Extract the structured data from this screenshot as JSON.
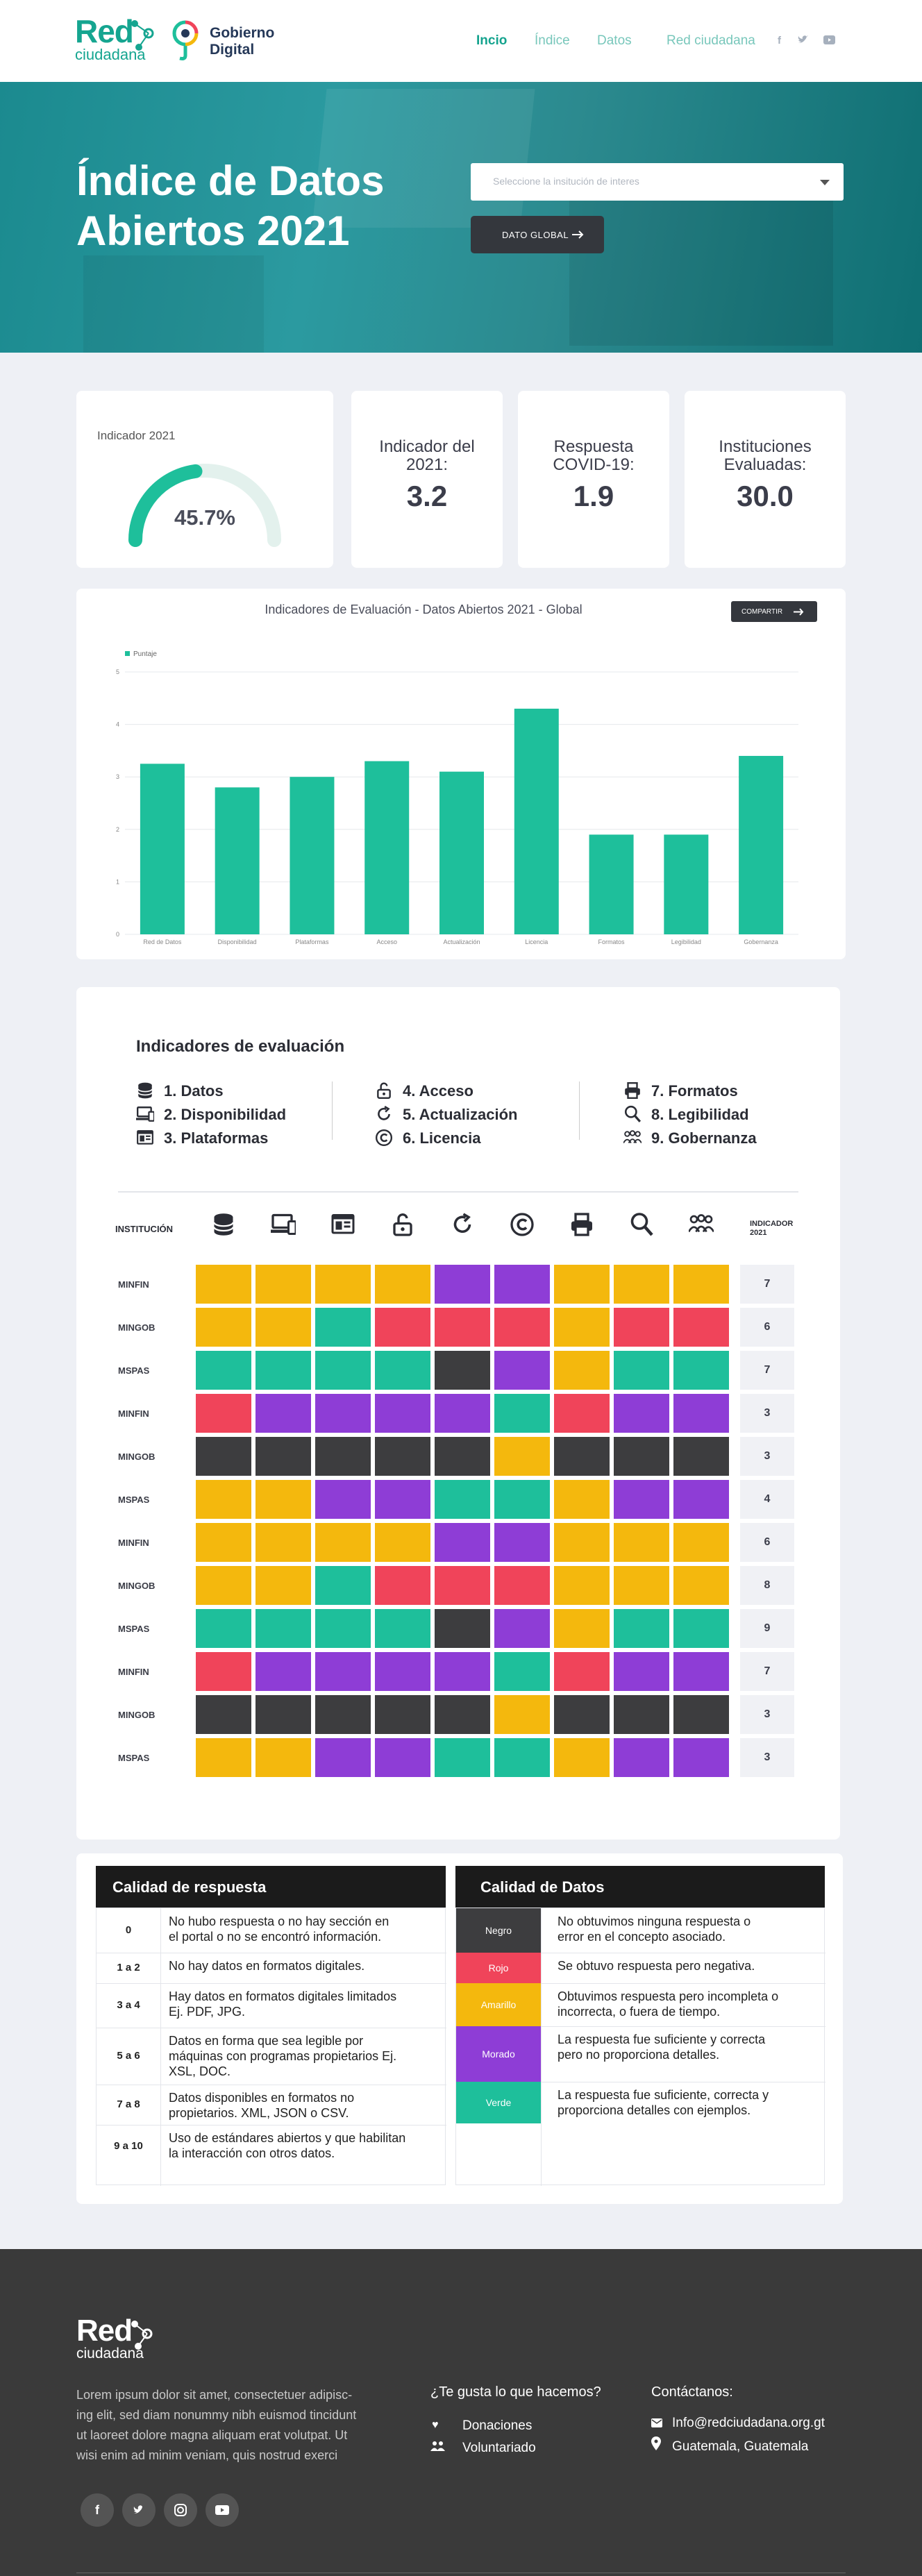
{
  "nav": {
    "logo_top": "Red",
    "logo_bottom": "ciudadana",
    "gob_line1": "Gobierno",
    "gob_line2": "Digital",
    "links": [
      "Incio",
      "Índice",
      "Datos",
      "Red ciudadana"
    ],
    "social": [
      "f",
      "t",
      "yt"
    ]
  },
  "hero": {
    "title_line1": "Índice de Datos",
    "title_line2": "Abiertos 2021",
    "select_placeholder": "Seleccione la insitución de  interes",
    "button_label": "DATO GLOBAL"
  },
  "stats": {
    "gauge_label": "Indicador 2021",
    "gauge_value": "45.7%",
    "gauge_fraction": 0.457,
    "cards": [
      {
        "label_l1": "Indicador del",
        "label_l2": "2021:",
        "value": "3.2"
      },
      {
        "label_l1": "Respuesta",
        "label_l2": "COVID-19:",
        "value": "1.9"
      },
      {
        "label_l1": "Instituciones",
        "label_l2": "Evaluadas:",
        "value": "30.0"
      }
    ]
  },
  "chart_section": {
    "title": "Indicadores de Evaluación - Datos Abiertos 2021 - Global",
    "share_label": "COMPARTIR"
  },
  "chart_data": {
    "type": "bar",
    "categories": [
      "Red de Datos",
      "Disponibilidad",
      "Plataformas",
      "Acceso",
      "Actualización",
      "Licencia",
      "Formatos",
      "Legibilidad",
      "Gobernanza"
    ],
    "series": [
      {
        "name": "Puntaje",
        "values": [
          3.25,
          2.8,
          3.0,
          3.3,
          3.1,
          4.3,
          1.9,
          1.9,
          3.4
        ],
        "color": "#1ebf9b"
      }
    ],
    "yticks": [
      "0",
      "1",
      "2",
      "3",
      "4",
      "5"
    ],
    "ylim": [
      0,
      5
    ],
    "grid": true,
    "legend": "top-left"
  },
  "indicators": {
    "title": "Indicadores de  evaluación",
    "legend": [
      {
        "label": "1. Datos",
        "icon": "database-icon"
      },
      {
        "label": "2. Disponibilidad",
        "icon": "devices-icon"
      },
      {
        "label": "3. Plataformas",
        "icon": "browser-icon"
      },
      {
        "label": "4. Acceso",
        "icon": "unlock-icon"
      },
      {
        "label": "5. Actualización",
        "icon": "refresh-icon"
      },
      {
        "label": "6. Licencia",
        "icon": "copyright-icon"
      },
      {
        "label": "7. Formatos",
        "icon": "printer-icon"
      },
      {
        "label": "8. Legibilidad",
        "icon": "magnifier-icon"
      },
      {
        "label": "9. Gobernanza",
        "icon": "people-icon"
      }
    ],
    "col_head_left": "INSTITUCIÓN",
    "col_head_right_l1": "INDICADOR",
    "col_head_right_l2": "2021",
    "colors": {
      "Y": "#f4b80d",
      "P": "#8e3dd6",
      "G": "#1ebf9b",
      "R": "#f0445a",
      "K": "#3d3d3f"
    },
    "rows": [
      {
        "inst": "MINFIN",
        "cells": "YYYYPPYYY",
        "score": "7"
      },
      {
        "inst": "MINGOB",
        "cells": "YYGRRRYRR",
        "score": "6"
      },
      {
        "inst": "MSPAS",
        "cells": "GGGGKPYGG",
        "score": "7"
      },
      {
        "inst": "MINFIN",
        "cells": "RPPPPGRPP",
        "score": "3"
      },
      {
        "inst": "MINGOB",
        "cells": "KKKKKYKKK",
        "score": "3"
      },
      {
        "inst": "MSPAS",
        "cells": "YYPPGGYPP",
        "score": "4"
      },
      {
        "inst": "MINFIN",
        "cells": "YYYYPPYYY",
        "score": "6"
      },
      {
        "inst": "MINGOB",
        "cells": "YYGRRRYYY",
        "score": "8"
      },
      {
        "inst": "MSPAS",
        "cells": "GGGGKPYGG",
        "score": "9"
      },
      {
        "inst": "MINFIN",
        "cells": "RPPPPGRPP",
        "score": "7"
      },
      {
        "inst": "MINGOB",
        "cells": "KKKKKYKKK",
        "score": "3"
      },
      {
        "inst": "MSPAS",
        "cells": "YYPPGGYPP",
        "score": "3"
      }
    ]
  },
  "quality": {
    "title": "Calidad de respuesta",
    "rows": [
      {
        "key": "0",
        "text_l1": "No hubo respuesta o no hay sección en",
        "text_l2": "el portal o no se encontró información."
      },
      {
        "key": "1 a 2",
        "text_l1": "No hay datos en formatos digitales.",
        "text_l2": ""
      },
      {
        "key": "3 a 4",
        "text_l1": "Hay datos en formatos digitales limitados",
        "text_l2": "Ej. PDF, JPG."
      },
      {
        "key": "5 a 6",
        "text_l1": "Datos en forma que sea legible por",
        "text_l2": "máquinas con programas propietarios Ej.",
        "text_l3": "XSL, DOC."
      },
      {
        "key": "7 a 8",
        "text_l1": "Datos disponibles en formatos no",
        "text_l2": "propietarios. XML, JSON o CSV."
      },
      {
        "key": "9 a 10",
        "text_l1": " Uso de estándares abiertos y que habilitan",
        "text_l2": "la interacción con otros datos."
      }
    ]
  },
  "data_quality": {
    "title": "Calidad de Datos",
    "rows": [
      {
        "chip": "Negro",
        "color": "#3d3d3f",
        "text_l1": "No obtuvimos ninguna respuesta o",
        "text_l2": "error en el concepto asociado."
      },
      {
        "chip": "Rojo",
        "color": "#f0445a",
        "text_l1": "Se obtuvo respuesta pero negativa.",
        "text_l2": ""
      },
      {
        "chip": "Amarillo",
        "color": "#f4b80d",
        "text_l1": "Obtuvimos respuesta pero incompleta o",
        "text_l2": "incorrecta, o fuera de tiempo."
      },
      {
        "chip": "Morado",
        "color": "#8e3dd6",
        "text_l1": "La respuesta fue suficiente y correcta",
        "text_l2": "pero no proporciona detalles."
      },
      {
        "chip": "Verde",
        "color": "#1ebf9b",
        "text_l1": "La respuesta fue suficiente, correcta y",
        "text_l2": "proporciona detalles con ejemplos."
      }
    ]
  },
  "footer": {
    "logo_top": "Red",
    "logo_bottom": "ciudadana",
    "about_l1": " Lorem ipsum dolor sit amet, consectetuer adipisc-",
    "about_l2": "ing elit, sed diam nonummy nibh euismod tincidunt",
    "about_l3": "ut laoreet dolore magna aliquam erat volutpat. Ut",
    "about_l4": "wisi enim ad minim veniam, quis nostrud exerci",
    "col2_title": "¿Te gusta lo que hacemos?",
    "col2_items": [
      "Donaciones",
      "Voluntariado"
    ],
    "col3_title": "Contáctanos:",
    "email": "Info@redciudadana.org.gt",
    "location": "Guatemala, Guatemala",
    "social": [
      "f",
      "t",
      "ig",
      "yt"
    ]
  }
}
